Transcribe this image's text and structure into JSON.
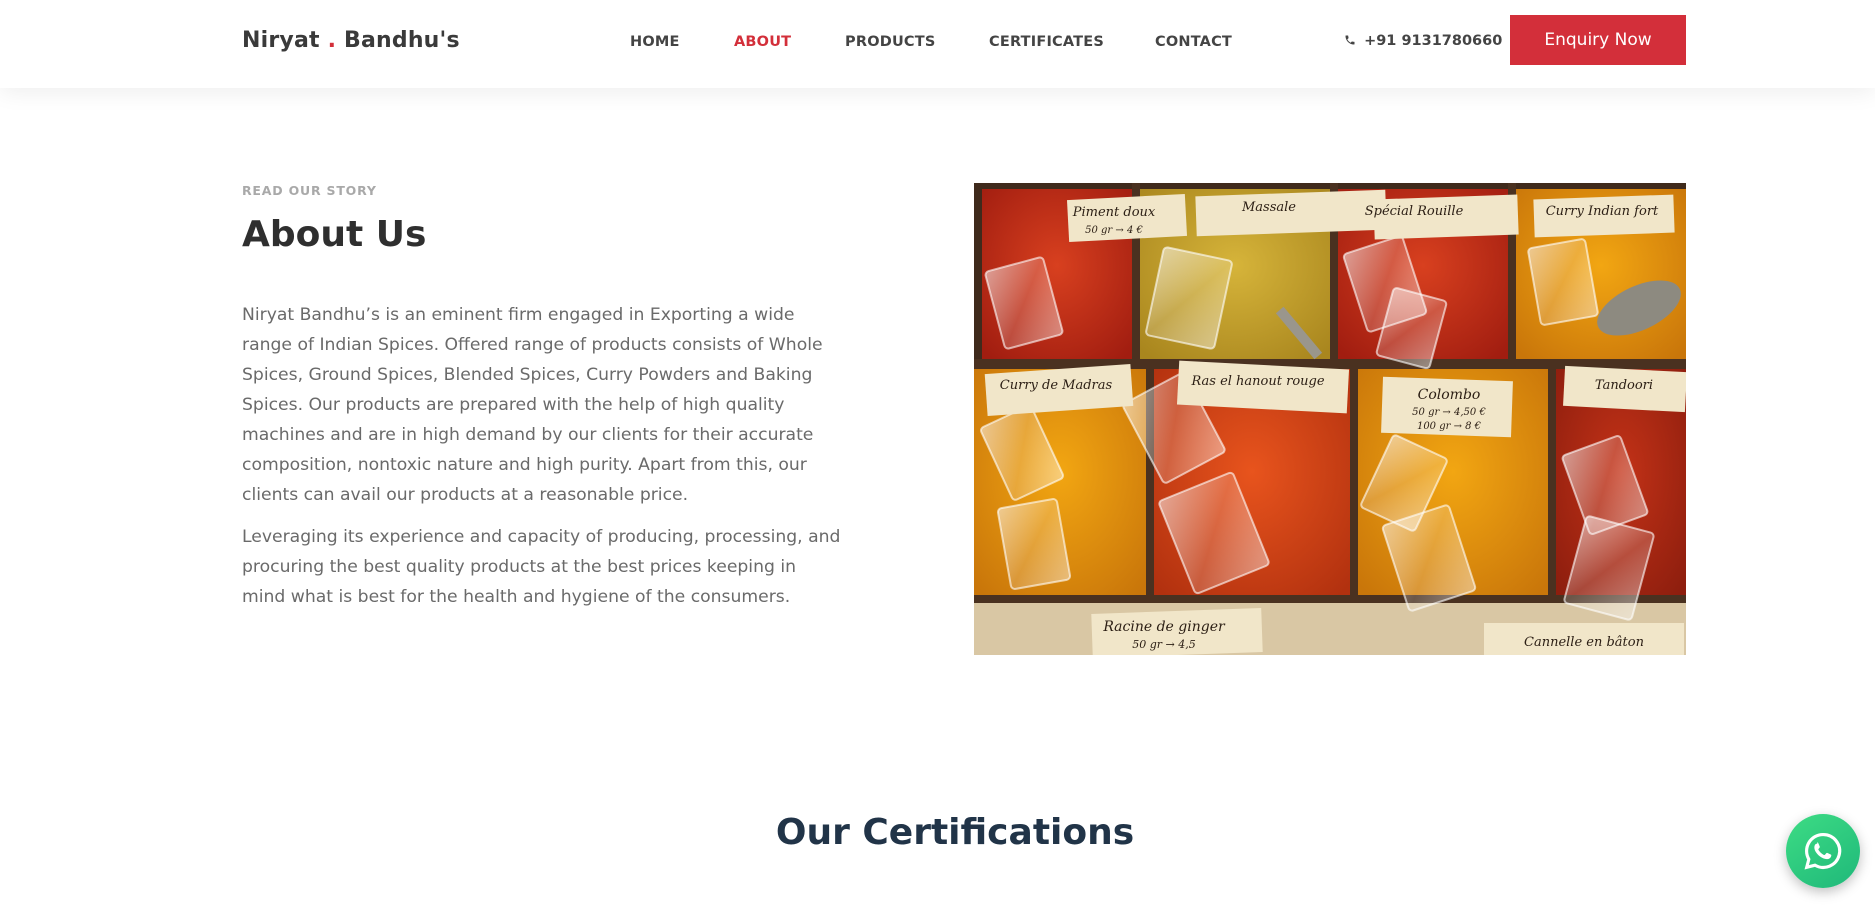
{
  "header": {
    "logo_part1": "Niryat",
    "logo_dot": ".",
    "logo_part2": "Bandhu's",
    "nav": [
      {
        "label": "HOME"
      },
      {
        "label": "ABOUT",
        "active": true
      },
      {
        "label": "PRODUCTS"
      },
      {
        "label": "CERTIFICATES"
      },
      {
        "label": "CONTACT"
      }
    ],
    "phone": "+91 9131780660",
    "enquiry_label": "Enquiry Now"
  },
  "about": {
    "eyebrow": "READ OUR STORY",
    "title": "About Us",
    "paragraph1": "Niryat Bandhu’s is an eminent firm engaged in Exporting a wide range of Indian Spices. Offered range of products consists of Whole Spices, Ground Spices, Blended Spices, Curry Powders and Baking Spices. Our products are prepared with the help of high quality machines and are in high demand by our clients for their accurate composition, nontoxic nature and high purity. Apart from this, our clients can avail our products at a reasonable price.",
    "paragraph2": "Leveraging its experience and capacity of producing, processing, and procuring the best quality products at the best prices keeping in mind what is best for the health and hygiene of the consumers."
  },
  "image": {
    "spice_labels": [
      {
        "name": "Piment doux",
        "price": "50 gr → 4 €"
      },
      {
        "name": "Massale",
        "price": ""
      },
      {
        "name": "Spécial Rouille",
        "price": ""
      },
      {
        "name": "Curry Indian fort",
        "price": ""
      },
      {
        "name": "Curry de Madras",
        "price": ""
      },
      {
        "name": "Ras el hanout rouge",
        "price": ""
      },
      {
        "name": "Colombo",
        "price": "50 gr → 4,50 €"
      },
      {
        "name": "Tandoori",
        "price": ""
      },
      {
        "name": "Racine de ginger",
        "price": "50 gr → 4,5"
      },
      {
        "name": "Cannelle en bâton",
        "price": ""
      }
    ],
    "colombo_price2": "100 gr → 8 €"
  },
  "certifications": {
    "title": "Our Certifications"
  },
  "colors": {
    "accent": "#d32f3a",
    "heading_dark": "#213448",
    "whatsapp": "#25d366"
  },
  "icons": [
    "phone-icon",
    "whatsapp-icon"
  ]
}
